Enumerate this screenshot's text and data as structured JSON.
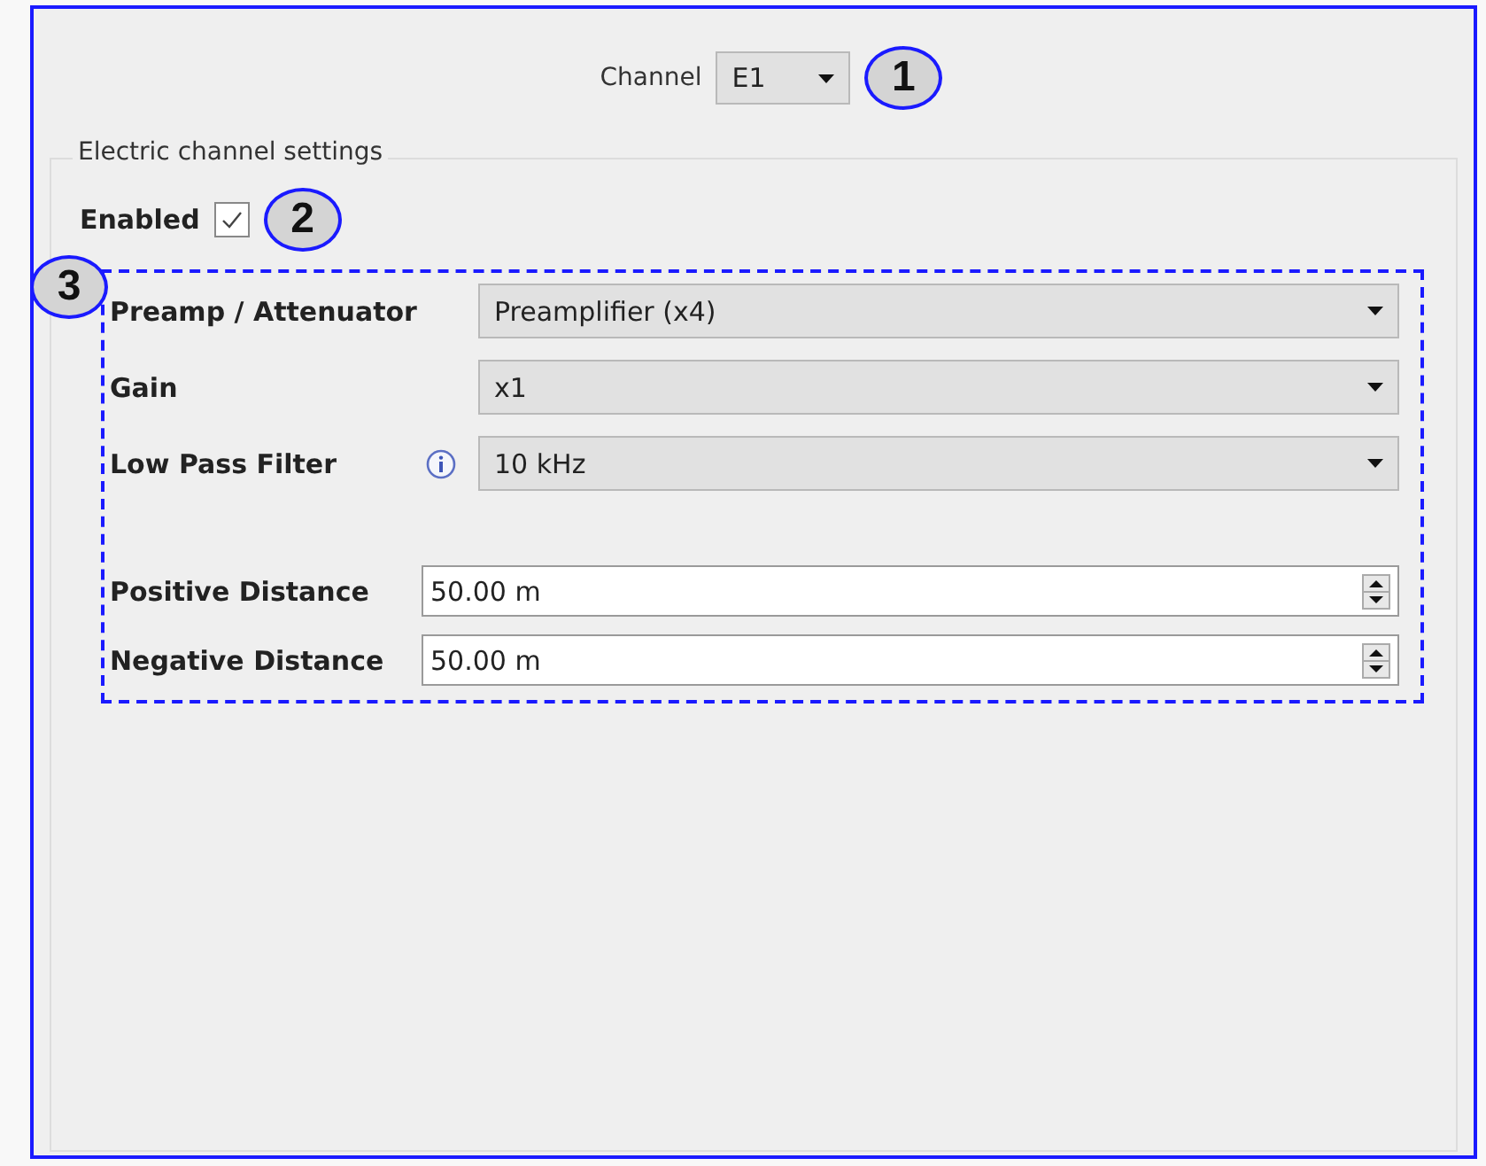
{
  "channel": {
    "label": "Channel",
    "value": "E1",
    "callout": "1"
  },
  "group": {
    "title": "Electric channel settings",
    "enabled": {
      "label": "Enabled",
      "checked": true,
      "callout": "2"
    },
    "section_callout": "3",
    "combos": [
      {
        "label": "Preamp / Attenuator",
        "value": "Preamplifier (x4)",
        "info": false
      },
      {
        "label": "Gain",
        "value": "x1",
        "info": false
      },
      {
        "label": "Low Pass Filter",
        "value": "10 kHz",
        "info": true
      }
    ],
    "spins": [
      {
        "label": "Positive Distance",
        "value": "50.00 m"
      },
      {
        "label": "Negative Distance",
        "value": "50.00 m"
      }
    ]
  }
}
